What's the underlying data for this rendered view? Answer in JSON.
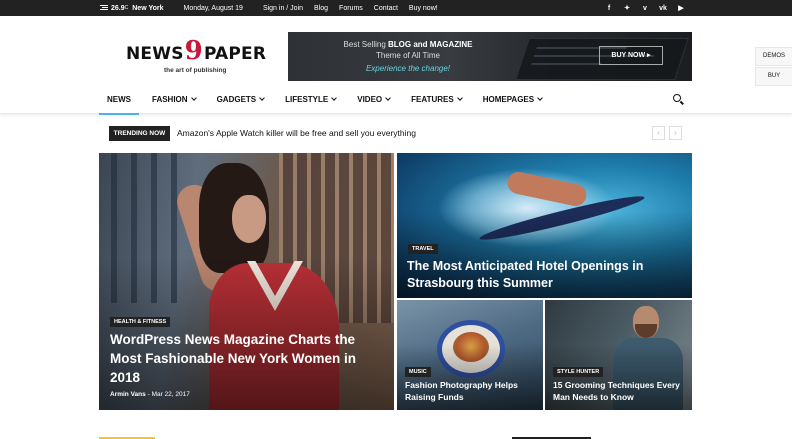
{
  "topbar": {
    "temperature": "26.9",
    "temp_unit": "C",
    "city": "New York",
    "date": "Monday, August 19",
    "links": [
      "Sign in / Join",
      "Blog",
      "Forums",
      "Contact",
      "Buy now!"
    ],
    "social_icons": [
      "facebook-icon",
      "twitter-icon",
      "vimeo-icon",
      "vk-icon",
      "youtube-icon"
    ]
  },
  "logo": {
    "word_left": "NEWS",
    "nine": "9",
    "word_right": "PAPER",
    "tagline": "the art of publishing"
  },
  "banner": {
    "line1_prefix": "Best Selling ",
    "line1_bold": "BLOG and MAGAZINE",
    "line2": "Theme of All Time",
    "line3": "Experience the change!",
    "button": "BUY NOW ▸"
  },
  "side_tabs": {
    "demos": "DEMOS",
    "buy": "BUY"
  },
  "nav": {
    "items": [
      {
        "label": "NEWS",
        "active": true,
        "dropdown": false
      },
      {
        "label": "FASHION",
        "dropdown": true
      },
      {
        "label": "GADGETS",
        "dropdown": true
      },
      {
        "label": "LIFESTYLE",
        "dropdown": true
      },
      {
        "label": "VIDEO",
        "dropdown": true
      },
      {
        "label": "FEATURES",
        "dropdown": true
      },
      {
        "label": "HOMEPAGES",
        "dropdown": true
      }
    ]
  },
  "trending": {
    "badge": "TRENDING NOW",
    "headline": "Amazon's Apple Watch killer will be free and sell you everything",
    "prev": "‹",
    "next": "›"
  },
  "tiles": {
    "main": {
      "category": "HEALTH & FITNESS",
      "title": "WordPress News Magazine Charts the Most Fashionable New York Women in 2018",
      "author": "Armin Vans",
      "separator": "-",
      "date": "Mar 22, 2017"
    },
    "top_right": {
      "category": "TRAVEL",
      "title": "The Most Anticipated Hotel Openings in Strasbourg this Summer"
    },
    "bottom_left": {
      "category": "MUSIC",
      "title": "Fashion Photography Helps Raising Funds"
    },
    "bottom_right": {
      "category": "STYLE HUNTER",
      "title": "15 Grooming Techniques Every Man Needs to Know"
    }
  },
  "colors": {
    "topbar_bg": "#222222",
    "accent_blue": "#4db2ec",
    "logo_nine": "#c8163c",
    "section_yellow": "#ffc02b"
  }
}
